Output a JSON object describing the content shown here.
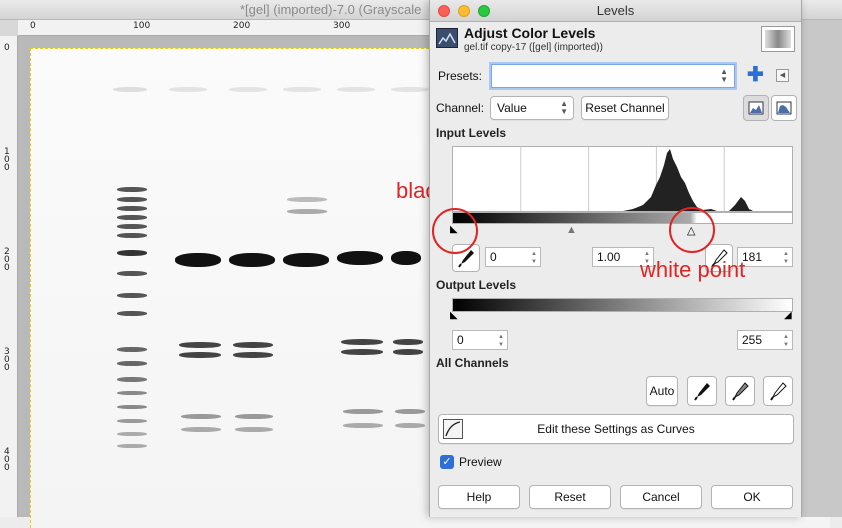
{
  "background_window": {
    "title": "*[gel] (imported)-7.0 (Grayscale",
    "ruler_h": [
      "0",
      "100",
      "200",
      "300"
    ],
    "ruler_v": [
      "0",
      "1\n0\n0",
      "2\n0\n0",
      "3\n0\n0",
      "4\n0\n0"
    ]
  },
  "annotations": {
    "black_point": "black point",
    "white_point": "white point"
  },
  "dialog": {
    "window_title": "Levels",
    "heading": "Adjust Color Levels",
    "subheading": "gel.tif copy-17 ([gel] (imported))",
    "presets_label": "Presets:",
    "presets_value": "",
    "channel_label": "Channel:",
    "channel_value": "Value",
    "reset_channel": "Reset Channel",
    "input_levels_label": "Input Levels",
    "input_low": "0",
    "input_gamma": "1.00",
    "input_high": "181",
    "output_levels_label": "Output Levels",
    "output_low": "0",
    "output_high": "255",
    "all_channels_label": "All Channels",
    "auto": "Auto",
    "edit_curves": "Edit these Settings as Curves",
    "preview_label": "Preview",
    "preview_checked": true,
    "help": "Help",
    "reset": "Reset",
    "cancel": "Cancel",
    "ok": "OK"
  },
  "colors": {
    "accent": "#2e6fd6",
    "annotation": "#e02424"
  }
}
